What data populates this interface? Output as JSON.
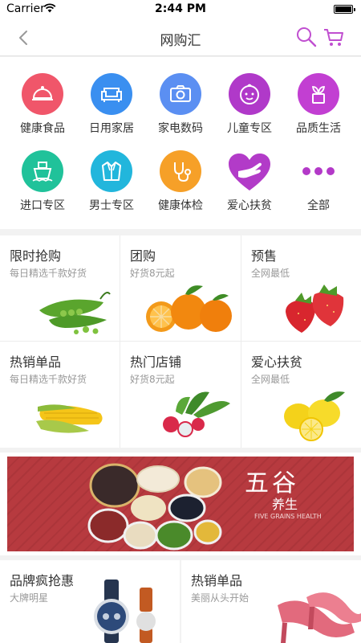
{
  "status_bar": {
    "carrier": "Carrier",
    "time": "2:44 PM"
  },
  "nav": {
    "title": "网购汇"
  },
  "categories": [
    {
      "label": "健康食品",
      "icon": "food-cover-icon",
      "color": "#f0566a"
    },
    {
      "label": "日用家居",
      "icon": "sofa-icon",
      "color": "#3a8ff0"
    },
    {
      "label": "家电数码",
      "icon": "camera-icon",
      "color": "#5b8ff2"
    },
    {
      "label": "儿童专区",
      "icon": "baby-face-icon",
      "color": "#b039c9"
    },
    {
      "label": "品质生活",
      "icon": "plant-pot-icon",
      "color": "#c23fd2"
    },
    {
      "label": "进口专区",
      "icon": "ship-icon",
      "color": "#20c29a"
    },
    {
      "label": "男士专区",
      "icon": "suit-icon",
      "color": "#22b6dc"
    },
    {
      "label": "健康体检",
      "icon": "stethoscope-icon",
      "color": "#f6a028"
    },
    {
      "label": "爱心扶贫",
      "icon": "heart-hand-icon",
      "color": "#b23bc8"
    },
    {
      "label": "全部",
      "icon": "more-dots-icon",
      "color": "#b339c8"
    }
  ],
  "promos": [
    {
      "title": "限时抢购",
      "subtitle": "每日精选千款好货",
      "image": "peas-image"
    },
    {
      "title": "团购",
      "subtitle": "好货8元起",
      "image": "oranges-image"
    },
    {
      "title": "预售",
      "subtitle": "全网最低",
      "image": "strawberries-image"
    },
    {
      "title": "热销单品",
      "subtitle": "每日精选千款好货",
      "image": "corn-image"
    },
    {
      "title": "热门店铺",
      "subtitle": "好货8元起",
      "image": "radish-image"
    },
    {
      "title": "爱心扶贫",
      "subtitle": "全网最低",
      "image": "lemons-image"
    }
  ],
  "banner": {
    "title": "五谷",
    "subtitle": "养生",
    "english": "FIVE GRAINS HEALTH"
  },
  "bottom_tiles": [
    {
      "title": "品牌疯抢惠",
      "subtitle": "大牌明星",
      "image": "watch-image"
    },
    {
      "title": "热销单品",
      "subtitle": "美丽从头开始",
      "image": "heels-image"
    }
  ],
  "colors": {
    "accent": "#b339c8",
    "nav_icon": "#c04fd0"
  }
}
